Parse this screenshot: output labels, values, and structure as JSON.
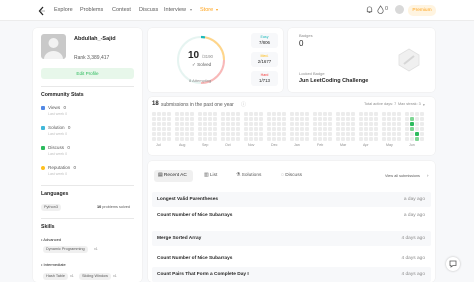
{
  "nav": {
    "links": [
      "Explore",
      "Problems",
      "Contest",
      "Discuss",
      "Interview",
      "Store"
    ],
    "premium": "Premium",
    "notifications": "0",
    "colors": {
      "accent": "#ffa116"
    }
  },
  "profile": {
    "name": "Abdullah_-Sajid",
    "rank": "Rank  3,389,417",
    "edit": "Edit Profile"
  },
  "community": {
    "title": "Community Stats",
    "items": [
      {
        "label": "Views",
        "value": "0",
        "sub": "Last week 0",
        "color": "#5389e5"
      },
      {
        "label": "Solution",
        "value": "0",
        "sub": "Last week 0",
        "color": "#41b8d9"
      },
      {
        "label": "Discuss",
        "value": "0",
        "sub": "Last week 0",
        "color": "#2cbb5d"
      },
      {
        "label": "Reputation",
        "value": "0",
        "sub": "Last week 0",
        "color": "#ffc01e"
      }
    ]
  },
  "languages": {
    "title": "Languages",
    "name": "Python3",
    "count": "10",
    "count_label": "problems solved"
  },
  "skills": {
    "title": "Skills",
    "advanced": "Advanced",
    "adv_tags": [
      {
        "t": "Dynamic Programming",
        "n": "x1"
      }
    ],
    "intermediate": "Intermediate",
    "int_tags": [
      {
        "t": "Hash Table",
        "n": "x1"
      },
      {
        "t": "Sliding Window",
        "n": "x1"
      }
    ]
  },
  "solved": {
    "count": "10",
    "total": "/3190",
    "label": "Solved",
    "attempting": "8 Attempting",
    "progress": 0.0031,
    "difficulty": [
      {
        "name": "Easy",
        "value": "7/806",
        "color": "#1cbaba"
      },
      {
        "name": "Med.",
        "value": "2/1677",
        "color": "#ffb700"
      },
      {
        "name": "Hard",
        "value": "1/713",
        "color": "#f63737"
      }
    ]
  },
  "badges": {
    "title": "Badges",
    "count": "0",
    "locked_label": "Locked Badge",
    "locked_name": "Jun LeetCoding Challenge"
  },
  "submissions": {
    "count": "18",
    "text": "submissions in the past one year",
    "active": "Total active days: 7",
    "streak": "Max streak: 3",
    "months": [
      "Jul",
      "Aug",
      "Sep",
      "Oct",
      "Nov",
      "Dec",
      "Jan",
      "Feb",
      "Mar",
      "Apr",
      "May",
      "Jun"
    ]
  },
  "tabs": [
    "Recent AC",
    "List",
    "Solutions",
    "Discuss"
  ],
  "view_all": "View all submissions",
  "recent": [
    {
      "title": "Longest Valid Parentheses",
      "when": "a day ago"
    },
    {
      "title": "Count Number of Nice Subarrays",
      "when": "a day ago"
    },
    {
      "title": "Merge Sorted Array",
      "when": "4 days ago"
    },
    {
      "title": "Count Number of Nice Subarrays",
      "when": "4 days ago"
    },
    {
      "title": "Count Pairs That Form a Complete Day I",
      "when": "4 days ago"
    }
  ]
}
